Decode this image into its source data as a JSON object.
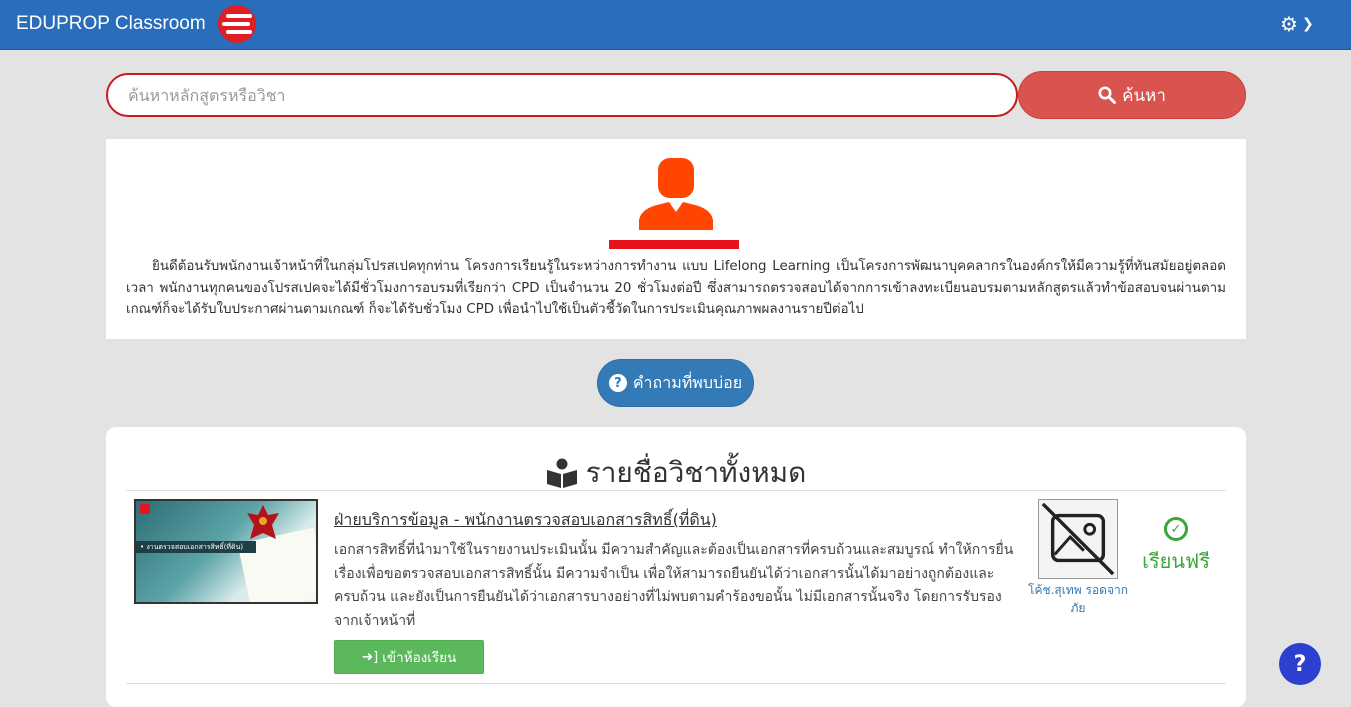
{
  "header": {
    "brand": "EDUPROP Classroom",
    "logo_icon": "eduprop-logo-icon",
    "settings_icon": "gear-icon",
    "dropdown_icon": "chevron-down-icon"
  },
  "search": {
    "placeholder": "ค้นหาหลักสูตรหรือวิชา",
    "button_label": "ค้นหา",
    "button_icon": "search-icon"
  },
  "welcome": {
    "avatar_icon": "user-icon",
    "text": "ยินดีต้อนรับพนักงานเจ้าหน้าที่ในกลุ่มโปรสเปคทุกท่าน โครงการเรียนรู้ในระหว่างการทำงาน แบบ Lifelong Learning เป็นโครงการพัฒนาบุคคลากรในองค์กรให้มีความรู้ที่ทันสมัยอยู่ตลอดเวลา พนักงานทุกคนของโปรสเปคจะได้มีชั่วโมงการอบรมที่เรียกว่า CPD เป็นจำนวน 20 ชั่วโมงต่อปี ซึ่งสามารถตรวจสอบได้จากการเข้าลงทะเบียนอบรมตามหลักสูตรแล้วทำข้อสอบจนผ่านตามเกณฑ์ก็จะได้รับใบประกาศผ่านตามเกณฑ์ ก็จะได้รับชั่วโมง CPD เพื่อนำไปใช้เป็นตัวชี้วัดในการประเมินคุณภาพผลงานรายปีต่อไป"
  },
  "faq": {
    "label": "คำถามที่พบบ่อย",
    "icon": "question-circle-icon"
  },
  "courses": {
    "heading": "รายชื่อวิชาทั้งหมด",
    "heading_icon": "book-reader-icon",
    "items": [
      {
        "title": "ฝ่ายบริการข้อมูล - พนักงานตรวจสอบเอกสารสิทธิ์(ที่ดิน)",
        "description": "เอกสารสิทธิ์ที่นำมาใช้ในรายงานประเมินนั้น มีความสำคัญและต้องเป็นเอกสารที่ครบถ้วนและสมบูรณ์ ทำให้การยื่นเรื่องเพื่อขอตรวจสอบเอกสารสิทธิ์นั้น มีความจำเป็น เพื่อให้สามารถยืนยันได้ว่าเอกสารนั้นได้มาอย่างถูกต้องและครบถ้วน และยังเป็นการยืนยันได้ว่าเอกสารบางอย่างที่ไม่พบตามคำร้องขอนั้น ไม่มีเอกสารนั้นจริง โดยการรับรองจากเจ้าหน้าที่",
        "thumbnail_text": "• งานตรวจสอบเอกสารสิทธิ์(ที่ดิน)",
        "enter_label": "เข้าห้องเรียน",
        "enter_icon": "sign-in-icon",
        "instructor": "โค้ช.สุเทพ รอดจากภัย",
        "instructor_image_icon": "no-image-icon",
        "price_label": "เรียนฟรี",
        "price_icon": "check-circle-icon"
      }
    ]
  },
  "help_fab_icon": "question-icon",
  "colors": {
    "navbar": "#2a6dbb",
    "search_border": "#c9191c",
    "search_button": "#d9534f",
    "avatar": "#ff4500",
    "faq_button": "#337ab7",
    "enter_button": "#5cb85c",
    "free_label": "#3aa63a",
    "help_fab": "#2c3fd0"
  }
}
